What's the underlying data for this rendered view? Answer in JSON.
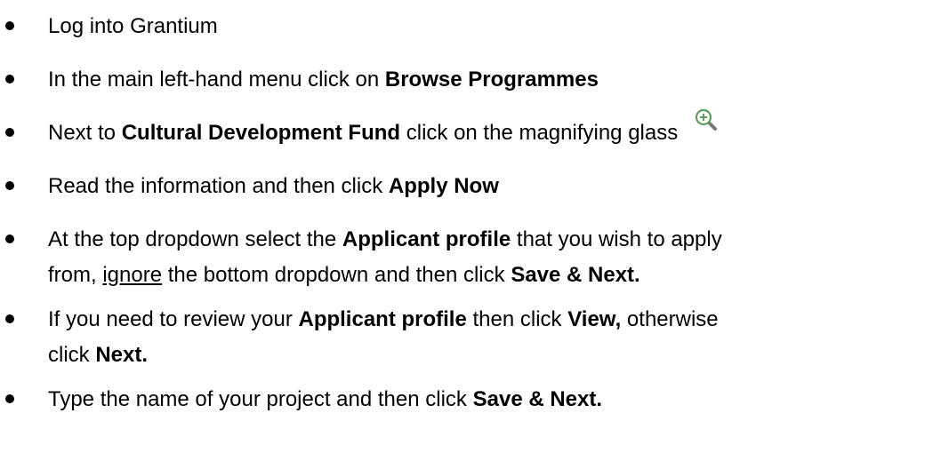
{
  "steps": [
    {
      "lines": [
        [
          {
            "t": "Log into Grantium"
          }
        ]
      ]
    },
    {
      "lines": [
        [
          {
            "t": "In the main left-hand menu click on "
          },
          {
            "t": "Browse Programmes",
            "b": true
          }
        ]
      ]
    },
    {
      "lines": [
        [
          {
            "t": "Next to "
          },
          {
            "t": "Cultural Development Fund",
            "b": true
          },
          {
            "t": " click on the magnifying glass "
          }
        ]
      ]
    },
    {
      "lines": [
        [
          {
            "t": "Read the information and then click "
          },
          {
            "t": "Apply Now",
            "b": true
          }
        ]
      ]
    },
    {
      "lines": [
        [
          {
            "t": "At the top dropdown select the "
          },
          {
            "t": "Applicant profile",
            "b": true
          },
          {
            "t": " that you wish to apply"
          }
        ],
        [
          {
            "t": "from, "
          },
          {
            "t": "ignore",
            "u": true
          },
          {
            "t": " the bottom dropdown and then click "
          },
          {
            "t": "Save & Next.",
            "b": true
          }
        ]
      ]
    },
    {
      "lines": [
        [
          {
            "t": "If you need to review your "
          },
          {
            "t": "Applicant profile",
            "b": true
          },
          {
            "t": " then click "
          },
          {
            "t": "View,",
            "b": true
          },
          {
            "t": " otherwise"
          }
        ],
        [
          {
            "t": "click "
          },
          {
            "t": "Next.",
            "b": true
          }
        ]
      ]
    },
    {
      "lines": [
        [
          {
            "t": "Type the name of your project and then click "
          },
          {
            "t": "Save & Next.",
            "b": true
          }
        ]
      ]
    }
  ],
  "icons": {
    "magnify": "zoom-in-magnifying-glass-icon"
  },
  "colors": {
    "text": "#000000",
    "icon_lens": "#5aa25a",
    "icon_handle": "#7a7a7a"
  }
}
